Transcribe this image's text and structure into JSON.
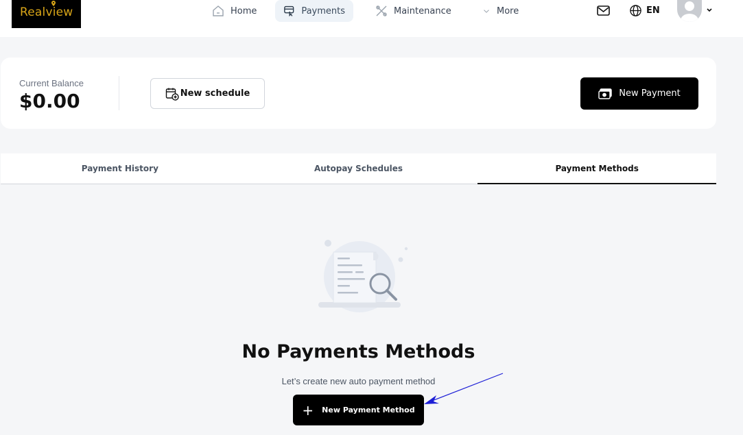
{
  "brand": {
    "name": "Realview",
    "color": "#d8a518"
  },
  "nav": {
    "items": [
      {
        "label": "Home",
        "icon": "home-icon"
      },
      {
        "label": "Payments",
        "icon": "payments-icon",
        "active": true
      },
      {
        "label": "Maintenance",
        "icon": "tools-icon"
      },
      {
        "label": "More",
        "icon": "chevron-down-icon"
      }
    ],
    "language": "EN"
  },
  "balance": {
    "label": "Current Balance",
    "value": "$0.00",
    "schedule_button": "New schedule",
    "new_payment_button": "New Payment"
  },
  "tabs": [
    {
      "label": "Payment History"
    },
    {
      "label": "Autopay Schedules"
    },
    {
      "label": "Payment Methods",
      "active": true
    }
  ],
  "empty_state": {
    "title": "No Payments Methods",
    "subtitle": "Let’s create new auto payment method",
    "button": "New Payment Method"
  },
  "colors": {
    "primary": "#000000",
    "annotation": "#1d1fd6"
  }
}
